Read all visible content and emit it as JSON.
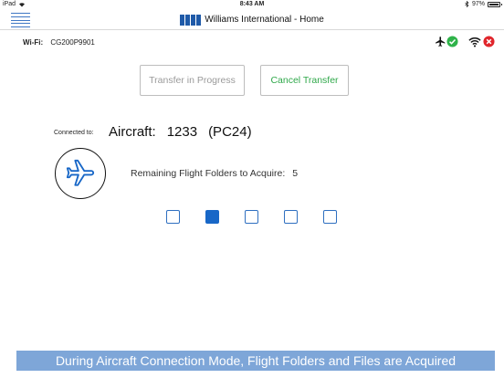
{
  "status_bar": {
    "device": "iPad",
    "time": "8:43 AM",
    "battery_percent": "97%",
    "battery_level": 0.97
  },
  "header": {
    "title": "Williams International - Home"
  },
  "wifi": {
    "label": "Wi-Fi:",
    "network": "CG200P9901"
  },
  "status_icons": {
    "aircraft_icon": "airplane-icon",
    "aircraft_ok_icon": "green-check-icon",
    "wifi_icon": "wifi-icon",
    "wifi_error_icon": "red-x-icon",
    "ok_color": "#2fb34a",
    "error_color": "#e0262c"
  },
  "buttons": {
    "transfer_label": "Transfer in Progress",
    "cancel_label": "Cancel Transfer"
  },
  "connection": {
    "connected_label": "Connected to:",
    "aircraft_label": "Aircraft:",
    "aircraft_number": "1233",
    "aircraft_model": "(PC24)"
  },
  "remaining": {
    "label": "Remaining Flight Folders to Acquire:",
    "count": "5"
  },
  "progress_boxes": {
    "total": 5,
    "active_index": 1
  },
  "footer": {
    "banner": "During Aircraft Connection Mode, Flight Folders and Files are Acquired"
  },
  "colors": {
    "accent": "#1867c7",
    "banner": "#7ea6d8",
    "cancel_text": "#2fa84a"
  }
}
